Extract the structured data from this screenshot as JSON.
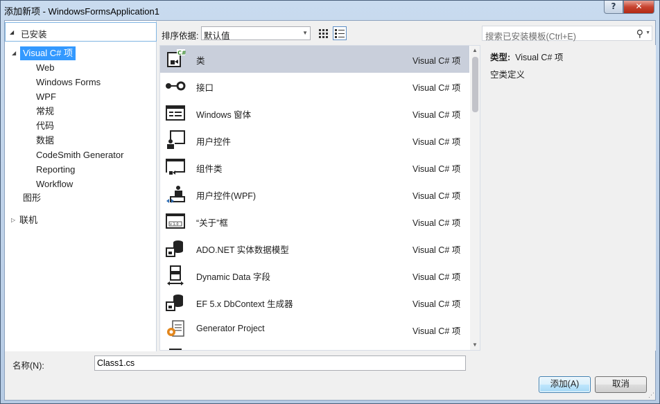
{
  "window": {
    "title": "添加新项 - WindowsFormsApplication1",
    "help": "?",
    "close": "✕"
  },
  "tree": {
    "installed": "已安装",
    "root": "Visual C# 项",
    "children": [
      "Web",
      "Windows Forms",
      "WPF",
      "常规",
      "代码",
      "数据",
      "CodeSmith Generator",
      "Reporting",
      "Workflow"
    ],
    "graphics": "图形",
    "online": "联机"
  },
  "toolbar": {
    "sort_label": "排序依据:",
    "sort_value": "默认值",
    "search_placeholder": "搜索已安装模板(Ctrl+E)"
  },
  "templates": [
    {
      "name": "类",
      "lang": "Visual C# 项",
      "icon": "class-icon",
      "selected": true
    },
    {
      "name": "接口",
      "lang": "Visual C# 项",
      "icon": "interface-icon"
    },
    {
      "name": "Windows 窗体",
      "lang": "Visual C# 项",
      "icon": "windows-form-icon"
    },
    {
      "name": "用户控件",
      "lang": "Visual C# 项",
      "icon": "user-control-icon"
    },
    {
      "name": "组件类",
      "lang": "Visual C# 项",
      "icon": "component-class-icon"
    },
    {
      "name": "用户控件(WPF)",
      "lang": "Visual C# 项",
      "icon": "wpf-user-control-icon"
    },
    {
      "name": "“关于”框",
      "lang": "Visual C# 项",
      "icon": "about-box-icon"
    },
    {
      "name": "ADO.NET 实体数据模型",
      "lang": "Visual C# 项",
      "icon": "entity-model-icon"
    },
    {
      "name": "Dynamic Data 字段",
      "lang": "Visual C# 项",
      "icon": "dynamic-data-field-icon"
    },
    {
      "name": "EF 5.x DbContext 生成器",
      "lang": "Visual C# 项",
      "icon": "dbcontext-generator-icon"
    },
    {
      "name": "Generator Project",
      "lang": "Visual C# 项",
      "icon": "generator-project-icon"
    },
    {
      "name": "",
      "lang": "",
      "icon": "partial-item-icon"
    }
  ],
  "details": {
    "type_label": "类型:",
    "type_value": "Visual C# 项",
    "description": "空类定义"
  },
  "footer": {
    "name_label": "名称(N):",
    "name_value": "Class1.cs",
    "add_label": "添加(A)",
    "cancel_label": "取消"
  },
  "colors": {
    "selection": "#3399ff",
    "selected_row": "#c9cfdb",
    "title_bar": "#c9dbef"
  }
}
